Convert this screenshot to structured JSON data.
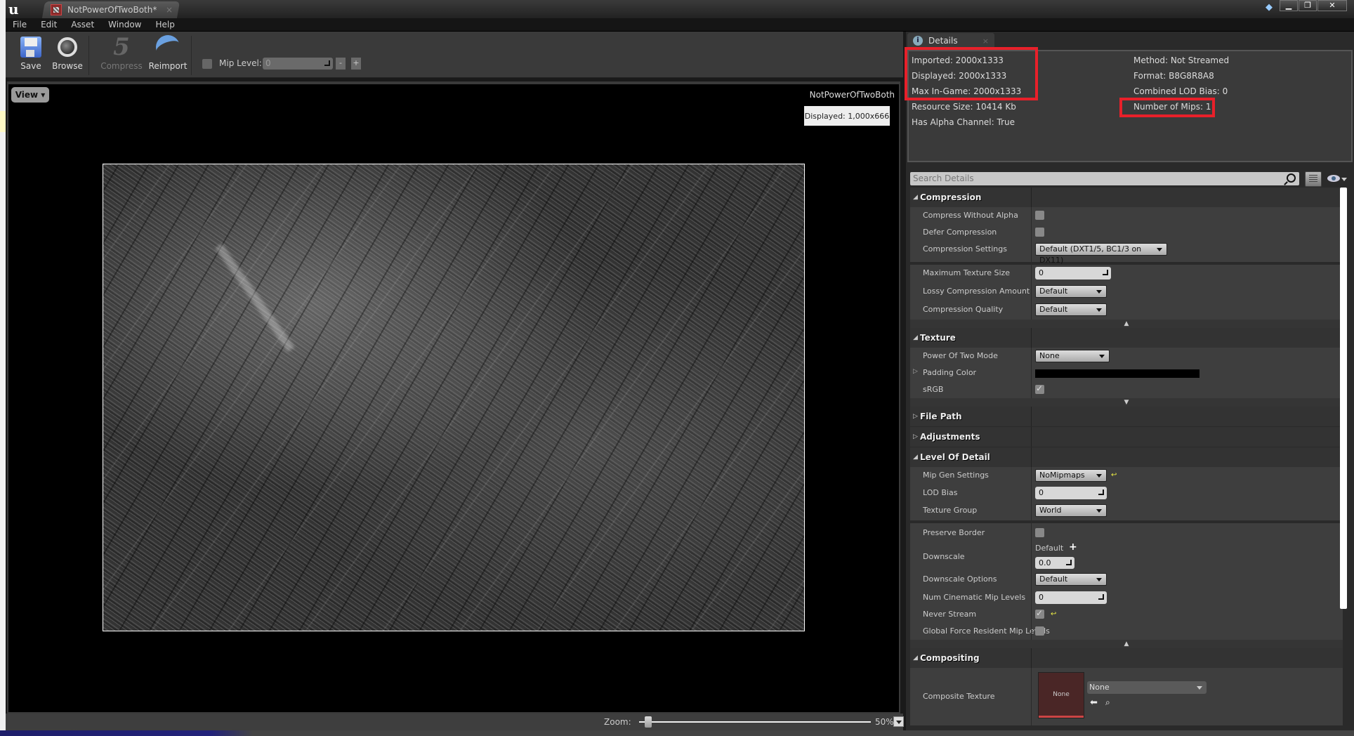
{
  "window": {
    "doc_tab_title": "NotPowerOfTwoBoth*",
    "tab_close": "×",
    "controls": {
      "minimize": "▁",
      "restore": "❐",
      "close": "✕"
    }
  },
  "menu": [
    "File",
    "Edit",
    "Asset",
    "Window",
    "Help"
  ],
  "toolbar": {
    "save": "Save",
    "browse": "Browse",
    "compress": "Compress",
    "reimport": "Reimport",
    "mip_label": "Mip Level:",
    "mip_value": "0",
    "minus": "-",
    "plus": "+"
  },
  "viewport": {
    "view_button": "View ▾",
    "asset_name": "NotPowerOfTwoBoth",
    "displayed_badge": "Displayed: 1,000x666"
  },
  "zoom": {
    "label": "Zoom:",
    "value": "50%",
    "slider_fraction": 0.03
  },
  "details": {
    "tab_label": "Details",
    "info_left": [
      "Imported: 2000x1333",
      "Displayed: 2000x1333",
      "Max In-Game: 2000x1333",
      "Resource Size: 10414 Kb",
      "Has Alpha Channel: True"
    ],
    "info_right": [
      "Method: Not Streamed",
      "Format: B8G8R8A8",
      "Combined LOD Bias: 0",
      "Number of Mips: 1"
    ],
    "search_placeholder": "Search Details",
    "categories": {
      "compression": {
        "title": "Compression",
        "compress_without_alpha": {
          "label": "Compress Without Alpha",
          "checked": false
        },
        "defer_compression": {
          "label": "Defer Compression",
          "checked": false
        },
        "compression_settings": {
          "label": "Compression Settings",
          "value": "Default (DXT1/5, BC1/3 on DX11)"
        },
        "max_texture_size": {
          "label": "Maximum Texture Size",
          "value": "0"
        },
        "lossy_compression": {
          "label": "Lossy Compression Amount",
          "value": "Default"
        },
        "compression_quality": {
          "label": "Compression Quality",
          "value": "Default"
        }
      },
      "texture": {
        "title": "Texture",
        "power_of_two": {
          "label": "Power Of Two Mode",
          "value": "None"
        },
        "padding_color": {
          "label": "Padding Color",
          "color": "#000000"
        },
        "srgb": {
          "label": "sRGB",
          "checked": true
        }
      },
      "file_path": {
        "title": "File Path"
      },
      "adjustments": {
        "title": "Adjustments"
      },
      "lod": {
        "title": "Level Of Detail",
        "mip_gen": {
          "label": "Mip Gen Settings",
          "value": "NoMipmaps"
        },
        "lod_bias": {
          "label": "LOD Bias",
          "value": "0"
        },
        "texture_group": {
          "label": "Texture Group",
          "value": "World"
        },
        "preserve_border": {
          "label": "Preserve Border",
          "checked": false
        },
        "downscale": {
          "label": "Downscale",
          "default_label": "Default",
          "value": "0.0"
        },
        "downscale_options": {
          "label": "Downscale Options",
          "value": "Default"
        },
        "num_cinematic": {
          "label": "Num Cinematic Mip Levels",
          "value": "0"
        },
        "never_stream": {
          "label": "Never Stream",
          "checked": true
        },
        "global_force_resident": {
          "label": "Global Force Resident Mip Levels",
          "checked": false
        }
      },
      "compositing": {
        "title": "Compositing",
        "composite_texture": {
          "label": "Composite Texture",
          "thumb_text": "None",
          "value": "None"
        }
      }
    }
  },
  "colors": {
    "highlight": "#e8202a",
    "accent": "#6aa0e0"
  }
}
